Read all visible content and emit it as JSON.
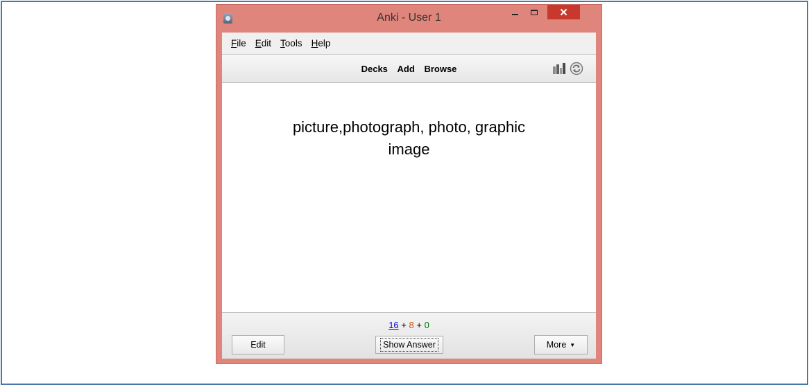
{
  "window": {
    "title": "Anki - User 1",
    "close_glyph": "✕"
  },
  "menu": [
    {
      "accel": "F",
      "rest": "ile"
    },
    {
      "accel": "E",
      "rest": "dit"
    },
    {
      "accel": "T",
      "rest": "ools"
    },
    {
      "accel": "H",
      "rest": "elp"
    }
  ],
  "toolbar": {
    "decks": "Decks",
    "add": "Add",
    "browse": "Browse",
    "icons": [
      "stats-icon",
      "sync-icon"
    ]
  },
  "card": {
    "line1": "picture,photograph, photo, graphic",
    "line2": "image"
  },
  "counts": {
    "new": "16",
    "sep1": "+",
    "learn": "8",
    "sep2": "+",
    "review": "0"
  },
  "buttons": {
    "edit": "Edit",
    "show_answer": "Show Answer",
    "more": "More",
    "more_caret": "▼"
  },
  "colors": {
    "frame_accent": "#e0857c",
    "close_button": "#c7392c",
    "new_count": "#0000cc",
    "learn_count": "#c35617",
    "review_count": "#007700"
  }
}
